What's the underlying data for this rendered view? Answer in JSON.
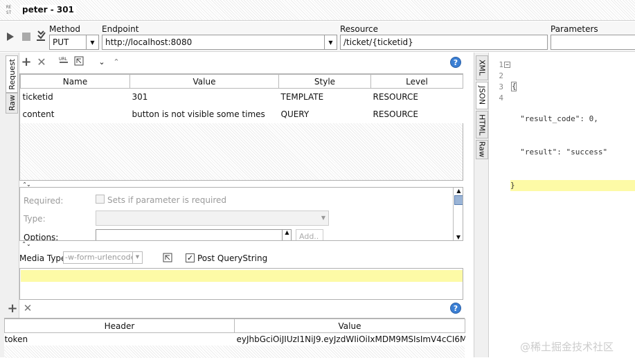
{
  "window": {
    "badge": "RE ST",
    "title": "peter - 301"
  },
  "toolbar": {
    "method_label": "Method",
    "method_value": "PUT",
    "endpoint_label": "Endpoint",
    "endpoint_value": "http://localhost:8080",
    "resource_label": "Resource",
    "resource_value": "/ticket/{ticketid}",
    "parameters_label": "Parameters"
  },
  "left_tabs": [
    "Request",
    "Raw"
  ],
  "params_table": {
    "headers": [
      "Name",
      "Value",
      "Style",
      "Level"
    ],
    "rows": [
      {
        "name": "ticketid",
        "value": "301",
        "style": "TEMPLATE",
        "level": "RESOURCE"
      },
      {
        "name": "content",
        "value": "button is not visible some times",
        "style": "QUERY",
        "level": "RESOURCE"
      }
    ]
  },
  "details": {
    "required_label": "Required:",
    "required_check": "Sets if parameter is required",
    "type_label": "Type:",
    "options_label": "Options:",
    "add_button": "Add.."
  },
  "media": {
    "label": "Media Type",
    "value": "-w-form-urlencoded",
    "post_qs_label": "Post QueryString",
    "post_qs_checked": true
  },
  "headers_table": {
    "headers": [
      "Header",
      "Value"
    ],
    "rows": [
      {
        "header": "token",
        "value": "eyJhbGciOiJIUzI1NiJ9.eyJzdWIiOiIxMDM9MSIsImV4cCI6MTUx..."
      }
    ]
  },
  "right_tabs": [
    "XML",
    "JSON",
    "HTML",
    "Raw"
  ],
  "response": {
    "line_numbers": [
      "1",
      "2",
      "3",
      "4"
    ],
    "lines": [
      "{",
      "  \"result_code\": 0,",
      "  \"result\": \"success\"",
      "}"
    ]
  },
  "watermark": "@稀土掘金技术社区",
  "colors": {
    "highlight": "#fdfaa6",
    "accent": "#3b7fd4"
  }
}
